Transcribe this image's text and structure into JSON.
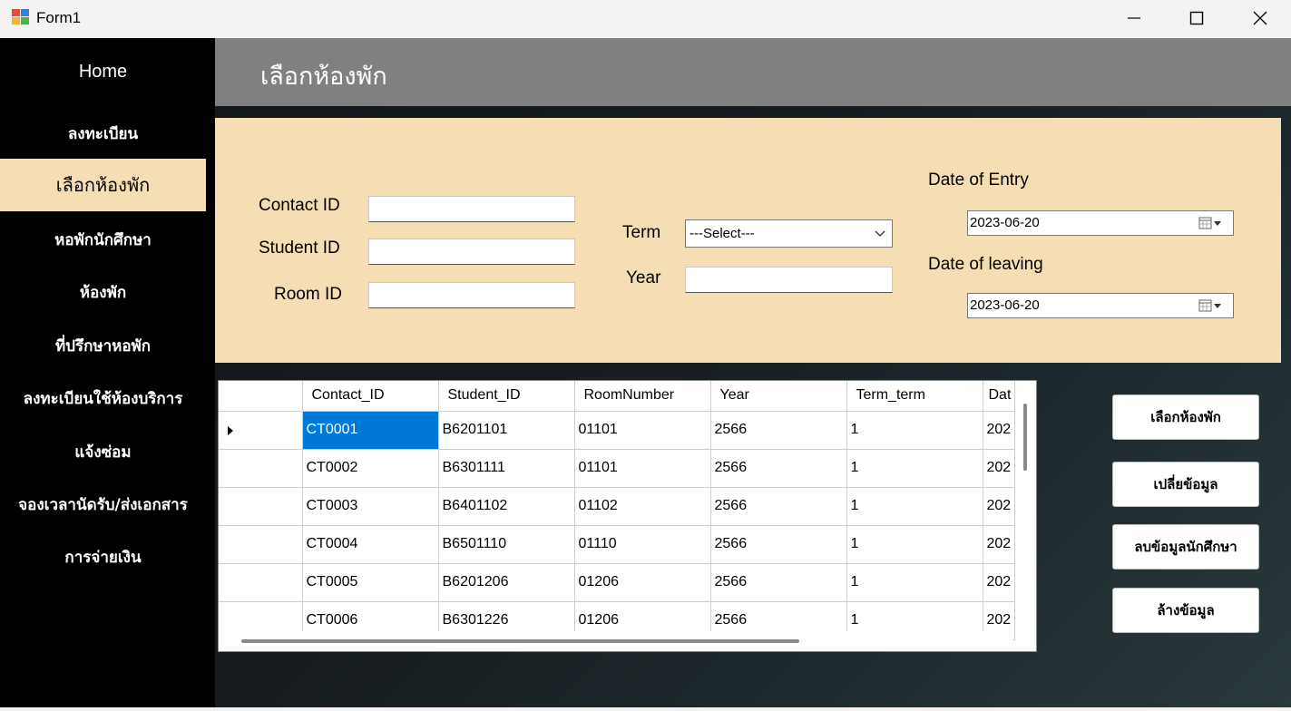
{
  "window": {
    "title": "Form1"
  },
  "sidebar": {
    "items": [
      {
        "label": "Home"
      },
      {
        "label": "ลงทะเบียน"
      },
      {
        "label": "เลือกห้องพัก",
        "active": true
      },
      {
        "label": "หอพักนักศึกษา"
      },
      {
        "label": "ห้องพัก"
      },
      {
        "label": "ที่ปรึกษาหอพัก"
      },
      {
        "label": "ลงทะเบียนใช้ห้องบริการ"
      },
      {
        "label": "แจ้งซ่อม"
      },
      {
        "label": "จองเวลานัดรับ/ส่งเอกสาร"
      },
      {
        "label": "การจ่ายเงิน"
      }
    ]
  },
  "header": {
    "title": "เลือกห้องพัก"
  },
  "form": {
    "contact_id_label": "Contact ID",
    "student_id_label": "Student ID",
    "room_id_label": "Room ID",
    "contact_id_value": "",
    "student_id_value": "",
    "room_id_value": "",
    "term_label": "Term",
    "term_value": "---Select---",
    "year_label": "Year",
    "year_value": "",
    "entry_label": "Date of Entry",
    "entry_value": "2023-06-20",
    "leaving_label": "Date of leaving",
    "leaving_value": "2023-06-20"
  },
  "grid": {
    "columns": [
      "Contact_ID",
      "Student_ID",
      "RoomNumber",
      "Year",
      "Term_term",
      "Dat"
    ],
    "rows": [
      [
        "CT0001",
        "B6201101",
        "01101",
        "2566",
        "1",
        "202"
      ],
      [
        "CT0002",
        "B6301111",
        "01101",
        "2566",
        "1",
        "202"
      ],
      [
        "CT0003",
        "B6401102",
        "01102",
        "2566",
        "1",
        "202"
      ],
      [
        "CT0004",
        "B6501110",
        "01110",
        "2566",
        "1",
        "202"
      ],
      [
        "CT0005",
        "B6201206",
        "01206",
        "2566",
        "1",
        "202"
      ],
      [
        "CT0006",
        "B6301226",
        "01206",
        "2566",
        "1",
        "202"
      ]
    ],
    "selected_row": 0
  },
  "actions": {
    "select_room": "เลือกห้องพัก",
    "change_data": "เปลี่ยข้อมูล",
    "delete_student": "ลบข้อมูลนักศึกษา",
    "clear_data": "ล้างข้อมูล"
  },
  "colors": {
    "sidebar_bg": "#000000",
    "active_item_bg": "#f5deb3",
    "header_bg": "#808080",
    "panel_bg": "#f5deb3",
    "selection": "#0078d7"
  }
}
